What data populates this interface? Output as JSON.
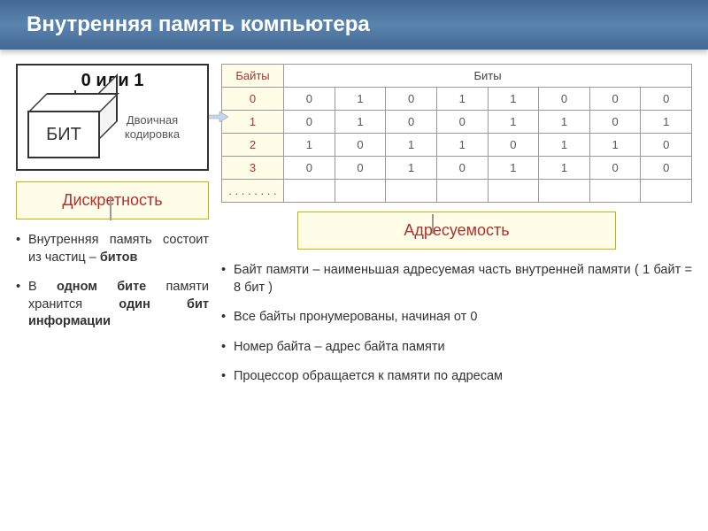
{
  "title": "Внутренняя память компьютера",
  "bit_box": {
    "top_label": "0 или 1",
    "cube_label": "БИТ",
    "binary_label": "Двоичная кодировка"
  },
  "discreteness": {
    "heading": "Дискретность",
    "bullets": [
      {
        "pre": "Внутренняя память состоит из частиц – ",
        "bold": "битов",
        "post": ""
      },
      {
        "pre": "В ",
        "bold": "одном бите",
        "mid": " памяти хранится ",
        "bold2": "один бит информации",
        "post": ""
      }
    ]
  },
  "addressability": {
    "heading": "Адресуемость",
    "bullets": [
      "Байт памяти – наименьшая адресуемая часть внутренней памяти ( 1 байт = 8 бит )",
      "Все байты пронумерованы, начиная от 0",
      "Номер байта – адрес байта памяти",
      "Процессор обращается к памяти по адресам"
    ]
  },
  "table": {
    "bytes_header": "Байты",
    "bits_header": "Биты",
    "ellipsis": ". . . . . . . .",
    "rows": [
      {
        "idx": "0",
        "bits": [
          "0",
          "1",
          "0",
          "1",
          "1",
          "0",
          "0",
          "0"
        ]
      },
      {
        "idx": "1",
        "bits": [
          "0",
          "1",
          "0",
          "0",
          "1",
          "1",
          "0",
          "1"
        ]
      },
      {
        "idx": "2",
        "bits": [
          "1",
          "0",
          "1",
          "1",
          "0",
          "1",
          "1",
          "0"
        ]
      },
      {
        "idx": "3",
        "bits": [
          "0",
          "0",
          "1",
          "0",
          "1",
          "1",
          "0",
          "0"
        ]
      }
    ]
  },
  "colors": {
    "accent_red": "#b03030",
    "accent_bg": "#fffde8",
    "header_grad": "#5a83ad"
  }
}
